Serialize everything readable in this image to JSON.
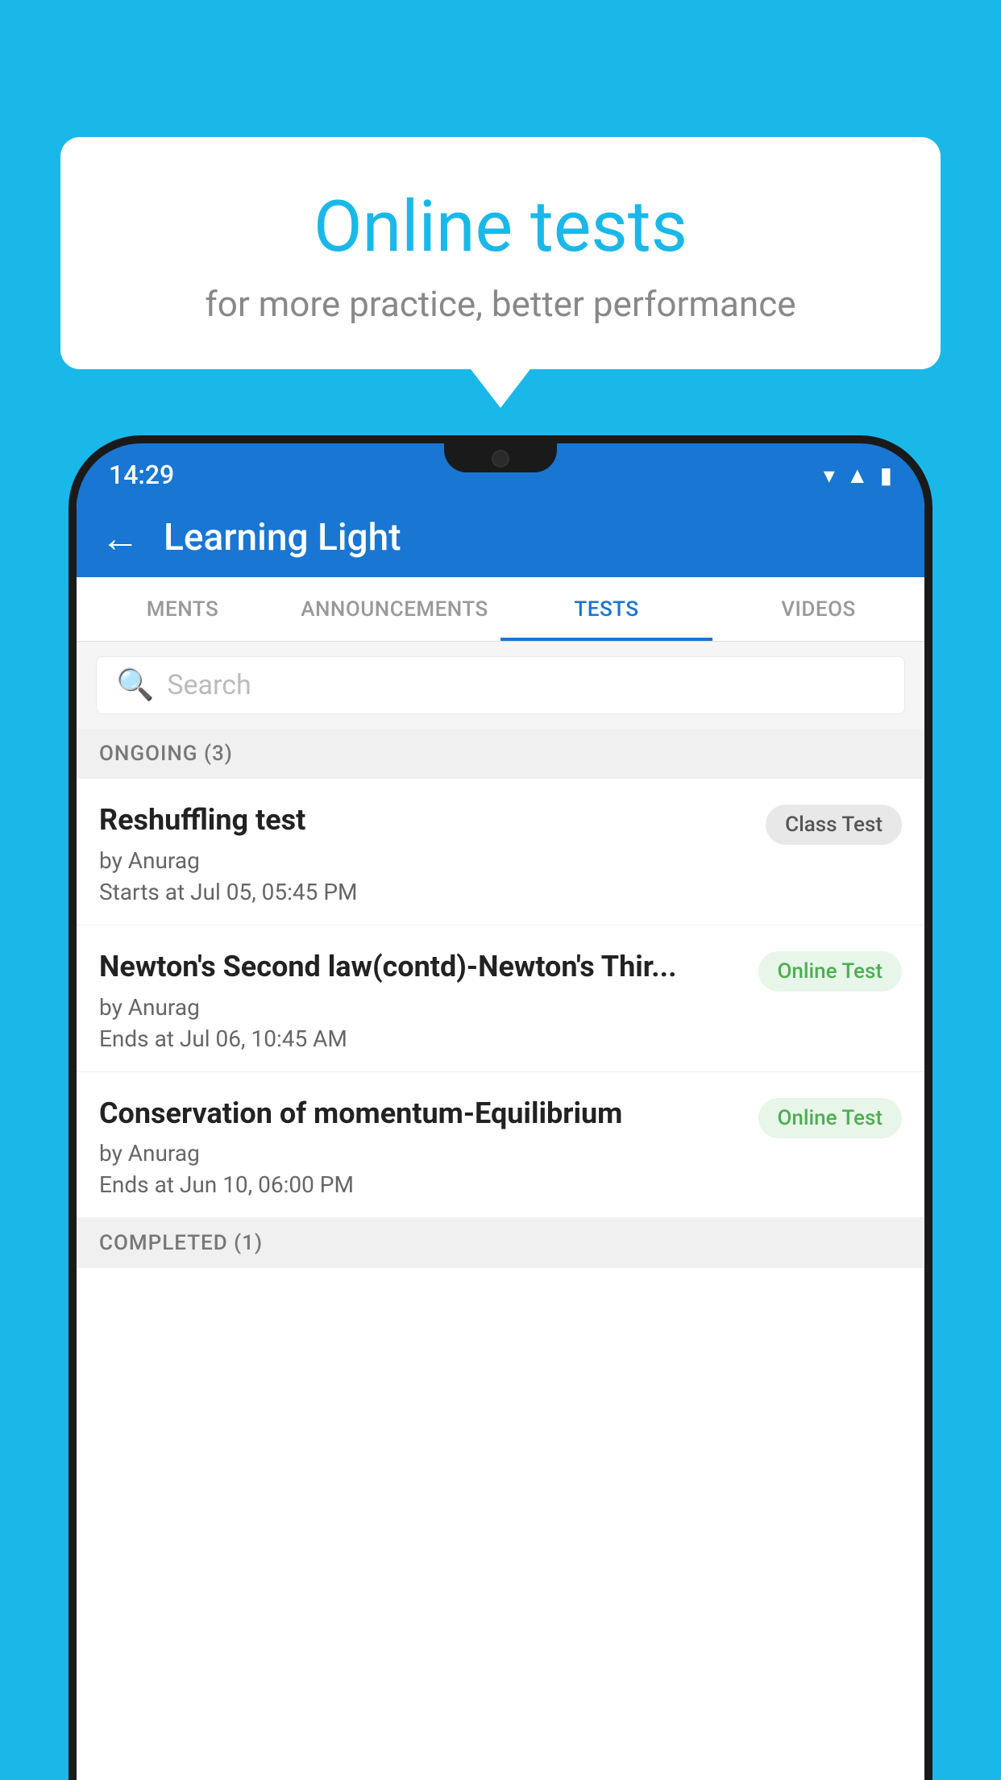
{
  "background": {
    "color": "#1ab8e8"
  },
  "speech_bubble": {
    "title": "Online tests",
    "subtitle": "for more practice, better performance"
  },
  "status_bar": {
    "time": "14:29",
    "icons": [
      "wifi",
      "signal",
      "battery"
    ]
  },
  "header": {
    "app_name": "Learning Light",
    "back_label": "←"
  },
  "tabs": [
    {
      "label": "MENTS",
      "active": false
    },
    {
      "label": "ANNOUNCEMENTS",
      "active": false
    },
    {
      "label": "TESTS",
      "active": true
    },
    {
      "label": "VIDEOS",
      "active": false
    }
  ],
  "search": {
    "placeholder": "Search"
  },
  "ongoing_section": {
    "label": "ONGOING (3)"
  },
  "tests": [
    {
      "title": "Reshuffling test",
      "author": "by Anurag",
      "date": "Starts at  Jul 05, 05:45 PM",
      "badge": "Class Test",
      "badge_type": "class"
    },
    {
      "title": "Newton's Second law(contd)-Newton's Thir...",
      "author": "by Anurag",
      "date": "Ends at  Jul 06, 10:45 AM",
      "badge": "Online Test",
      "badge_type": "online"
    },
    {
      "title": "Conservation of momentum-Equilibrium",
      "author": "by Anurag",
      "date": "Ends at  Jun 10, 06:00 PM",
      "badge": "Online Test",
      "badge_type": "online"
    }
  ],
  "completed_section": {
    "label": "COMPLETED (1)"
  }
}
